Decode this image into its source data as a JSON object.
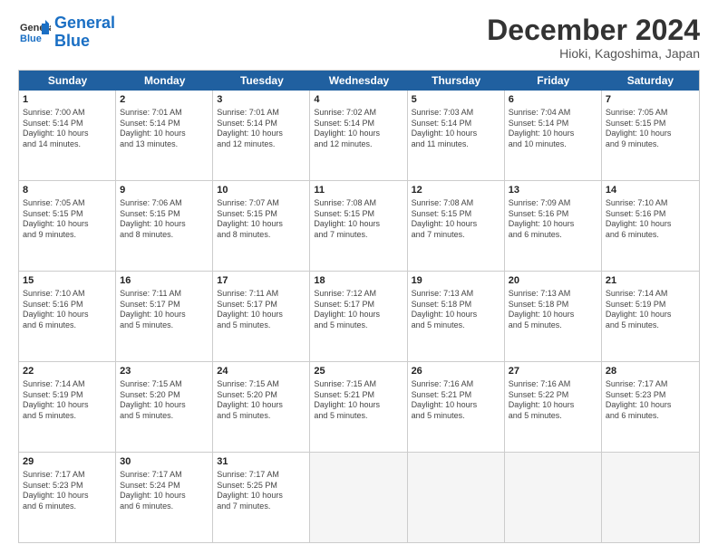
{
  "logo": {
    "line1": "General",
    "line2": "Blue"
  },
  "title": "December 2024",
  "subtitle": "Hioki, Kagoshima, Japan",
  "days_of_week": [
    "Sunday",
    "Monday",
    "Tuesday",
    "Wednesday",
    "Thursday",
    "Friday",
    "Saturday"
  ],
  "weeks": [
    [
      {
        "day": "1",
        "info": "Sunrise: 7:00 AM\nSunset: 5:14 PM\nDaylight: 10 hours\nand 14 minutes."
      },
      {
        "day": "2",
        "info": "Sunrise: 7:01 AM\nSunset: 5:14 PM\nDaylight: 10 hours\nand 13 minutes."
      },
      {
        "day": "3",
        "info": "Sunrise: 7:01 AM\nSunset: 5:14 PM\nDaylight: 10 hours\nand 12 minutes."
      },
      {
        "day": "4",
        "info": "Sunrise: 7:02 AM\nSunset: 5:14 PM\nDaylight: 10 hours\nand 12 minutes."
      },
      {
        "day": "5",
        "info": "Sunrise: 7:03 AM\nSunset: 5:14 PM\nDaylight: 10 hours\nand 11 minutes."
      },
      {
        "day": "6",
        "info": "Sunrise: 7:04 AM\nSunset: 5:14 PM\nDaylight: 10 hours\nand 10 minutes."
      },
      {
        "day": "7",
        "info": "Sunrise: 7:05 AM\nSunset: 5:15 PM\nDaylight: 10 hours\nand 9 minutes."
      }
    ],
    [
      {
        "day": "8",
        "info": "Sunrise: 7:05 AM\nSunset: 5:15 PM\nDaylight: 10 hours\nand 9 minutes."
      },
      {
        "day": "9",
        "info": "Sunrise: 7:06 AM\nSunset: 5:15 PM\nDaylight: 10 hours\nand 8 minutes."
      },
      {
        "day": "10",
        "info": "Sunrise: 7:07 AM\nSunset: 5:15 PM\nDaylight: 10 hours\nand 8 minutes."
      },
      {
        "day": "11",
        "info": "Sunrise: 7:08 AM\nSunset: 5:15 PM\nDaylight: 10 hours\nand 7 minutes."
      },
      {
        "day": "12",
        "info": "Sunrise: 7:08 AM\nSunset: 5:15 PM\nDaylight: 10 hours\nand 7 minutes."
      },
      {
        "day": "13",
        "info": "Sunrise: 7:09 AM\nSunset: 5:16 PM\nDaylight: 10 hours\nand 6 minutes."
      },
      {
        "day": "14",
        "info": "Sunrise: 7:10 AM\nSunset: 5:16 PM\nDaylight: 10 hours\nand 6 minutes."
      }
    ],
    [
      {
        "day": "15",
        "info": "Sunrise: 7:10 AM\nSunset: 5:16 PM\nDaylight: 10 hours\nand 6 minutes."
      },
      {
        "day": "16",
        "info": "Sunrise: 7:11 AM\nSunset: 5:17 PM\nDaylight: 10 hours\nand 5 minutes."
      },
      {
        "day": "17",
        "info": "Sunrise: 7:11 AM\nSunset: 5:17 PM\nDaylight: 10 hours\nand 5 minutes."
      },
      {
        "day": "18",
        "info": "Sunrise: 7:12 AM\nSunset: 5:17 PM\nDaylight: 10 hours\nand 5 minutes."
      },
      {
        "day": "19",
        "info": "Sunrise: 7:13 AM\nSunset: 5:18 PM\nDaylight: 10 hours\nand 5 minutes."
      },
      {
        "day": "20",
        "info": "Sunrise: 7:13 AM\nSunset: 5:18 PM\nDaylight: 10 hours\nand 5 minutes."
      },
      {
        "day": "21",
        "info": "Sunrise: 7:14 AM\nSunset: 5:19 PM\nDaylight: 10 hours\nand 5 minutes."
      }
    ],
    [
      {
        "day": "22",
        "info": "Sunrise: 7:14 AM\nSunset: 5:19 PM\nDaylight: 10 hours\nand 5 minutes."
      },
      {
        "day": "23",
        "info": "Sunrise: 7:15 AM\nSunset: 5:20 PM\nDaylight: 10 hours\nand 5 minutes."
      },
      {
        "day": "24",
        "info": "Sunrise: 7:15 AM\nSunset: 5:20 PM\nDaylight: 10 hours\nand 5 minutes."
      },
      {
        "day": "25",
        "info": "Sunrise: 7:15 AM\nSunset: 5:21 PM\nDaylight: 10 hours\nand 5 minutes."
      },
      {
        "day": "26",
        "info": "Sunrise: 7:16 AM\nSunset: 5:21 PM\nDaylight: 10 hours\nand 5 minutes."
      },
      {
        "day": "27",
        "info": "Sunrise: 7:16 AM\nSunset: 5:22 PM\nDaylight: 10 hours\nand 5 minutes."
      },
      {
        "day": "28",
        "info": "Sunrise: 7:17 AM\nSunset: 5:23 PM\nDaylight: 10 hours\nand 6 minutes."
      }
    ],
    [
      {
        "day": "29",
        "info": "Sunrise: 7:17 AM\nSunset: 5:23 PM\nDaylight: 10 hours\nand 6 minutes."
      },
      {
        "day": "30",
        "info": "Sunrise: 7:17 AM\nSunset: 5:24 PM\nDaylight: 10 hours\nand 6 minutes."
      },
      {
        "day": "31",
        "info": "Sunrise: 7:17 AM\nSunset: 5:25 PM\nDaylight: 10 hours\nand 7 minutes."
      },
      {
        "day": "",
        "info": ""
      },
      {
        "day": "",
        "info": ""
      },
      {
        "day": "",
        "info": ""
      },
      {
        "day": "",
        "info": ""
      }
    ]
  ]
}
